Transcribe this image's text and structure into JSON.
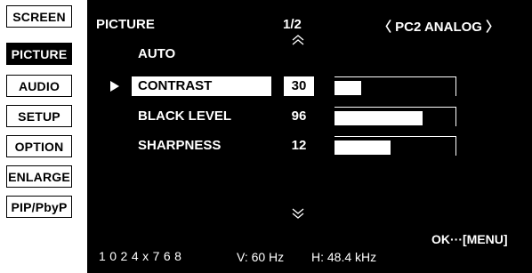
{
  "tabs": [
    {
      "label": "SCREEN",
      "active": false
    },
    {
      "label": "PICTURE",
      "active": true
    },
    {
      "label": "AUDIO",
      "active": false
    },
    {
      "label": "SETUP",
      "active": false
    },
    {
      "label": "OPTION",
      "active": false
    },
    {
      "label": "ENLARGE",
      "active": false
    },
    {
      "label": "PIP/PbyP",
      "active": false
    }
  ],
  "header": {
    "title": "PICTURE",
    "page": "1/2",
    "input_source": "〈 PC2 ANALOG 〉"
  },
  "icons": {
    "scroll_up": "double-chevron-up-icon",
    "scroll_down": "double-chevron-down-icon",
    "selection_pointer": "triangle-right-icon"
  },
  "items": [
    {
      "label": "AUTO"
    },
    {
      "label": "CONTRAST",
      "value": "30",
      "level": 0.22,
      "selected": true
    },
    {
      "label": "BLACK LEVEL",
      "value": "96",
      "level": 0.73,
      "selected": false
    },
    {
      "label": "SHARPNESS",
      "value": "12",
      "level": 0.46,
      "selected": false
    }
  ],
  "footer": {
    "resolution": "1 0 2 4 x 7 6 8",
    "v_freq": "V: 60 Hz",
    "h_freq": "H: 48.4 kHz",
    "ok_hint": "OK···[MENU]"
  }
}
